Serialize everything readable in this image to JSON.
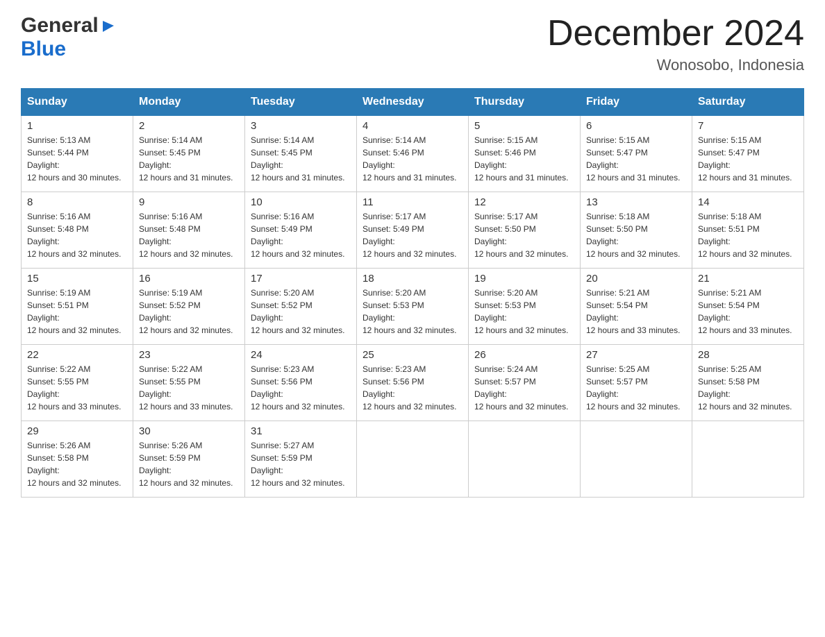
{
  "header": {
    "logo": {
      "general": "General",
      "blue": "Blue"
    },
    "title": "December 2024",
    "location": "Wonosobo, Indonesia"
  },
  "weekdays": [
    "Sunday",
    "Monday",
    "Tuesday",
    "Wednesday",
    "Thursday",
    "Friday",
    "Saturday"
  ],
  "weeks": [
    [
      {
        "day": "1",
        "sunrise": "5:13 AM",
        "sunset": "5:44 PM",
        "daylight": "12 hours and 30 minutes."
      },
      {
        "day": "2",
        "sunrise": "5:14 AM",
        "sunset": "5:45 PM",
        "daylight": "12 hours and 31 minutes."
      },
      {
        "day": "3",
        "sunrise": "5:14 AM",
        "sunset": "5:45 PM",
        "daylight": "12 hours and 31 minutes."
      },
      {
        "day": "4",
        "sunrise": "5:14 AM",
        "sunset": "5:46 PM",
        "daylight": "12 hours and 31 minutes."
      },
      {
        "day": "5",
        "sunrise": "5:15 AM",
        "sunset": "5:46 PM",
        "daylight": "12 hours and 31 minutes."
      },
      {
        "day": "6",
        "sunrise": "5:15 AM",
        "sunset": "5:47 PM",
        "daylight": "12 hours and 31 minutes."
      },
      {
        "day": "7",
        "sunrise": "5:15 AM",
        "sunset": "5:47 PM",
        "daylight": "12 hours and 31 minutes."
      }
    ],
    [
      {
        "day": "8",
        "sunrise": "5:16 AM",
        "sunset": "5:48 PM",
        "daylight": "12 hours and 32 minutes."
      },
      {
        "day": "9",
        "sunrise": "5:16 AM",
        "sunset": "5:48 PM",
        "daylight": "12 hours and 32 minutes."
      },
      {
        "day": "10",
        "sunrise": "5:16 AM",
        "sunset": "5:49 PM",
        "daylight": "12 hours and 32 minutes."
      },
      {
        "day": "11",
        "sunrise": "5:17 AM",
        "sunset": "5:49 PM",
        "daylight": "12 hours and 32 minutes."
      },
      {
        "day": "12",
        "sunrise": "5:17 AM",
        "sunset": "5:50 PM",
        "daylight": "12 hours and 32 minutes."
      },
      {
        "day": "13",
        "sunrise": "5:18 AM",
        "sunset": "5:50 PM",
        "daylight": "12 hours and 32 minutes."
      },
      {
        "day": "14",
        "sunrise": "5:18 AM",
        "sunset": "5:51 PM",
        "daylight": "12 hours and 32 minutes."
      }
    ],
    [
      {
        "day": "15",
        "sunrise": "5:19 AM",
        "sunset": "5:51 PM",
        "daylight": "12 hours and 32 minutes."
      },
      {
        "day": "16",
        "sunrise": "5:19 AM",
        "sunset": "5:52 PM",
        "daylight": "12 hours and 32 minutes."
      },
      {
        "day": "17",
        "sunrise": "5:20 AM",
        "sunset": "5:52 PM",
        "daylight": "12 hours and 32 minutes."
      },
      {
        "day": "18",
        "sunrise": "5:20 AM",
        "sunset": "5:53 PM",
        "daylight": "12 hours and 32 minutes."
      },
      {
        "day": "19",
        "sunrise": "5:20 AM",
        "sunset": "5:53 PM",
        "daylight": "12 hours and 32 minutes."
      },
      {
        "day": "20",
        "sunrise": "5:21 AM",
        "sunset": "5:54 PM",
        "daylight": "12 hours and 33 minutes."
      },
      {
        "day": "21",
        "sunrise": "5:21 AM",
        "sunset": "5:54 PM",
        "daylight": "12 hours and 33 minutes."
      }
    ],
    [
      {
        "day": "22",
        "sunrise": "5:22 AM",
        "sunset": "5:55 PM",
        "daylight": "12 hours and 33 minutes."
      },
      {
        "day": "23",
        "sunrise": "5:22 AM",
        "sunset": "5:55 PM",
        "daylight": "12 hours and 33 minutes."
      },
      {
        "day": "24",
        "sunrise": "5:23 AM",
        "sunset": "5:56 PM",
        "daylight": "12 hours and 32 minutes."
      },
      {
        "day": "25",
        "sunrise": "5:23 AM",
        "sunset": "5:56 PM",
        "daylight": "12 hours and 32 minutes."
      },
      {
        "day": "26",
        "sunrise": "5:24 AM",
        "sunset": "5:57 PM",
        "daylight": "12 hours and 32 minutes."
      },
      {
        "day": "27",
        "sunrise": "5:25 AM",
        "sunset": "5:57 PM",
        "daylight": "12 hours and 32 minutes."
      },
      {
        "day": "28",
        "sunrise": "5:25 AM",
        "sunset": "5:58 PM",
        "daylight": "12 hours and 32 minutes."
      }
    ],
    [
      {
        "day": "29",
        "sunrise": "5:26 AM",
        "sunset": "5:58 PM",
        "daylight": "12 hours and 32 minutes."
      },
      {
        "day": "30",
        "sunrise": "5:26 AM",
        "sunset": "5:59 PM",
        "daylight": "12 hours and 32 minutes."
      },
      {
        "day": "31",
        "sunrise": "5:27 AM",
        "sunset": "5:59 PM",
        "daylight": "12 hours and 32 minutes."
      },
      null,
      null,
      null,
      null
    ]
  ],
  "labels": {
    "sunrise": "Sunrise:",
    "sunset": "Sunset:",
    "daylight": "Daylight:"
  }
}
